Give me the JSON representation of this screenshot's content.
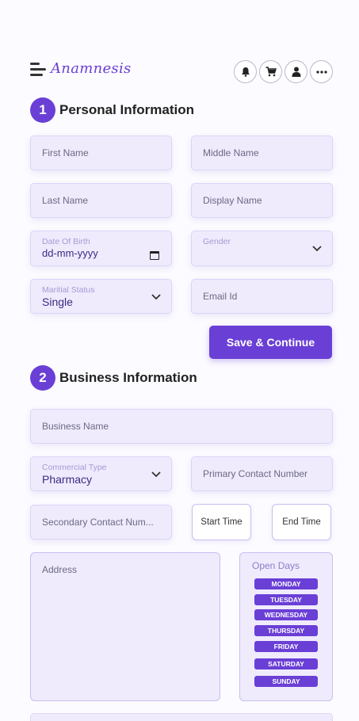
{
  "header": {
    "brand": "Anamnesis",
    "icons": [
      "bell-icon",
      "cart-icon",
      "user-icon",
      "more-icon"
    ]
  },
  "personal": {
    "step": "1",
    "title": "Personal Information",
    "first_name_ph": "First Name",
    "middle_name_ph": "Middle Name",
    "last_name_ph": "Last Name",
    "display_name_ph": "Display Name",
    "dob_label": "Date Of Birth",
    "dob_value": "dd-mm-yyyy",
    "gender_label": "Gender",
    "marital_label": "Maritial Status",
    "marital_value": "Single",
    "email_ph": "Email Id",
    "save_label": "Save & Continue"
  },
  "business": {
    "step": "2",
    "title": "Business Information",
    "business_name_ph": "Business Name",
    "commercial_label": "Commercial Type",
    "commercial_value": "Pharmacy",
    "primary_contact_ph": "Primary Contact Number",
    "secondary_contact_ph": "Secondary Contact Num...",
    "start_time": "Start Time",
    "end_time": "End Time",
    "address_ph": "Address",
    "open_days_title": "Open Days",
    "days": [
      "MONDAY",
      "TUESDAY",
      "WEDNESDAY",
      "THURSDAY",
      "FRIDAY",
      "SATURDAY",
      "SUNDAY"
    ]
  },
  "colors": {
    "accent": "#6a3fd6",
    "field_bg": "#efebfd",
    "field_border": "#ddd4f7"
  }
}
